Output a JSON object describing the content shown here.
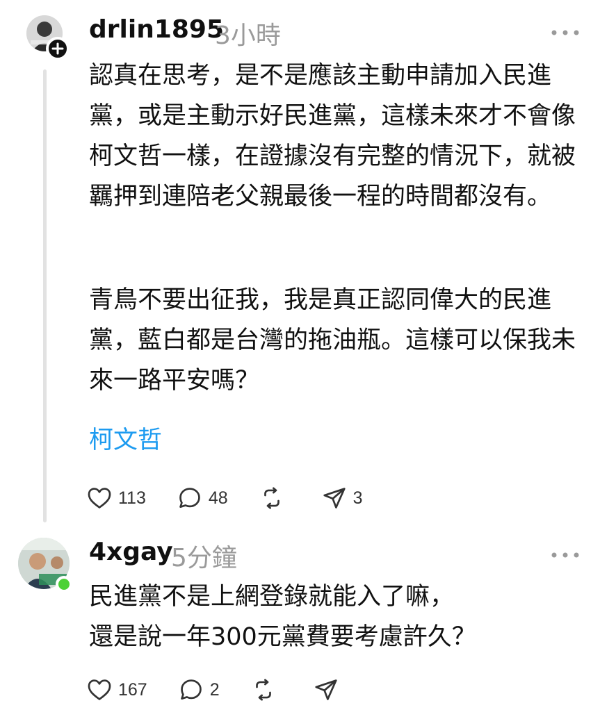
{
  "posts": [
    {
      "username": "drlin1895",
      "time": "3小時",
      "paragraphs": [
        "認真在思考，是不是應該主動申請加入民進黨，或是主動示好民進黨，這樣未來才不會像柯文哲一樣，在證據沒有完整的情況下，就被羈押到連陪老父親最後一程的時間都沒有。",
        "青鳥不要出征我，我是真正認同偉大的民進黨，藍白都是台灣的拖油瓶。這樣可以保我未來一路平安嗎？"
      ],
      "tag": "柯文哲",
      "likes": "113",
      "comments": "48",
      "reposts": "",
      "shares": "3"
    },
    {
      "username": "4xgay",
      "time": "5分鐘",
      "text": "民進黨不是上網登錄就能入了嘛，\n還是說一年300元黨費要考慮許久？",
      "likes": "167",
      "comments": "2",
      "reposts": "",
      "shares": ""
    }
  ],
  "icons": {
    "like": "heart-icon",
    "comment": "comment-bubble-icon",
    "repost": "repost-icon",
    "share": "send-icon",
    "more": "more-dots-icon",
    "follow": "plus-icon"
  },
  "colors": {
    "link": "#1d9bf0",
    "muted": "#9a9a9a",
    "online": "#4cd137"
  }
}
